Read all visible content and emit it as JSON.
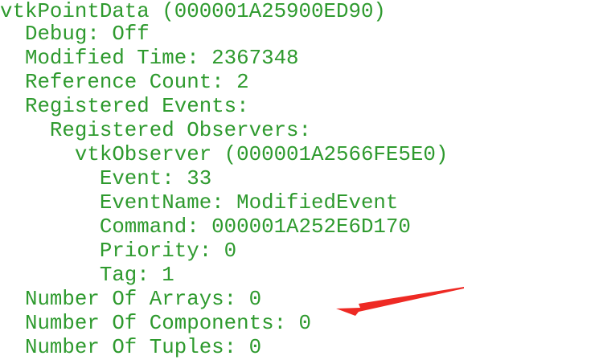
{
  "console": {
    "text_color": "#2e9a2e",
    "lines": [
      "vtkPointData (000001A25900ED90)",
      "  Debug: Off",
      "  Modified Time: 2367348",
      "  Reference Count: 2",
      "  Registered Events:",
      "    Registered Observers:",
      "      vtkObserver (000001A2566FE5E0)",
      "        Event: 33",
      "        EventName: ModifiedEvent",
      "        Command: 000001A252E6D170",
      "        Priority: 0",
      "        Tag: 1",
      "  Number Of Arrays: 0",
      "  Number Of Components: 0",
      "  Number Of Tuples: 0"
    ]
  },
  "annotation": {
    "arrow_color": "#ee2a24",
    "icon": "red-arrow-icon"
  }
}
